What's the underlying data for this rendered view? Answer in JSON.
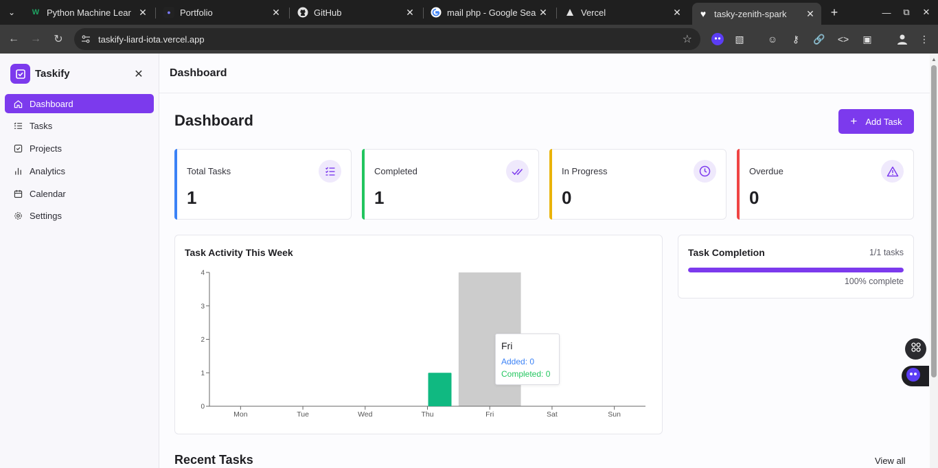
{
  "browser": {
    "tabs": [
      {
        "title": "Python Machine Lear",
        "icon": "w-logo-icon"
      },
      {
        "title": "Portfolio",
        "icon": "portfolio-icon"
      },
      {
        "title": "GitHub",
        "icon": "github-icon"
      },
      {
        "title": "mail php - Google Sea",
        "icon": "google-icon"
      },
      {
        "title": "Vercel",
        "icon": "vercel-icon"
      },
      {
        "title": "tasky-zenith-spark",
        "icon": "heart-icon",
        "active": true
      }
    ],
    "url": "taskify-liard-iota.vercel.app"
  },
  "sidebar": {
    "brand": "Taskify",
    "items": [
      {
        "label": "Dashboard",
        "icon": "home-icon",
        "active": true
      },
      {
        "label": "Tasks",
        "icon": "list-icon"
      },
      {
        "label": "Projects",
        "icon": "check-square-icon"
      },
      {
        "label": "Analytics",
        "icon": "bar-chart-icon"
      },
      {
        "label": "Calendar",
        "icon": "calendar-icon"
      },
      {
        "label": "Settings",
        "icon": "gear-icon"
      }
    ]
  },
  "header": {
    "title": "Dashboard"
  },
  "main": {
    "title": "Dashboard",
    "add_task_label": "Add Task",
    "stats": [
      {
        "label": "Total Tasks",
        "value": "1",
        "accent": "#3b82f6",
        "icon": "list-check-icon"
      },
      {
        "label": "Completed",
        "value": "1",
        "accent": "#22c55e",
        "icon": "double-check-icon"
      },
      {
        "label": "In Progress",
        "value": "0",
        "accent": "#eab308",
        "icon": "clock-icon"
      },
      {
        "label": "Overdue",
        "value": "0",
        "accent": "#ef4444",
        "icon": "alert-triangle-icon"
      }
    ],
    "completion": {
      "title": "Task Completion",
      "count_text": "1/1 tasks",
      "percent_text": "100% complete",
      "fraction": 1.0
    },
    "recent_title": "Recent Tasks",
    "view_all_label": "View all"
  },
  "chart_data": {
    "type": "bar",
    "title": "Task Activity This Week",
    "categories": [
      "Mon",
      "Tue",
      "Wed",
      "Thu",
      "Fri",
      "Sat",
      "Sun"
    ],
    "series": [
      {
        "name": "Added",
        "color": "#3b82f6",
        "values": [
          0,
          0,
          0,
          0,
          0,
          0,
          0
        ]
      },
      {
        "name": "Completed",
        "color": "#10b981",
        "values": [
          0,
          0,
          0,
          1,
          0,
          0,
          0
        ]
      }
    ],
    "yticks": [
      0,
      1,
      2,
      3,
      4
    ],
    "ylim": [
      0,
      4
    ],
    "highlighted_category": "Fri",
    "tooltip": {
      "title": "Fri",
      "rows": [
        "Added: 0",
        "Completed: 0"
      ]
    }
  },
  "colors": {
    "accent": "#7c3aed",
    "added": "#3b82f6",
    "completed": "#10b981"
  }
}
